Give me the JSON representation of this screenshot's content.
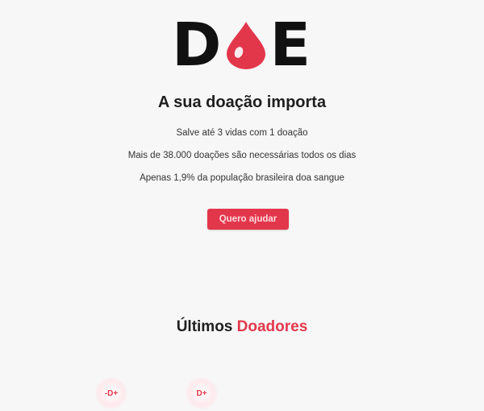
{
  "logo": {
    "left_letter": "D",
    "right_letter": "E",
    "drop_color": "#e2374b"
  },
  "hero": {
    "title": "A sua doação importa",
    "facts": [
      "Salve até 3 vidas com 1 doação",
      "Mais de 38.000 doações são necessárias todos os dias",
      "Apenas 1,9% da população brasileira doa sangue"
    ],
    "cta_label": "Quero ajudar"
  },
  "donors_section": {
    "title_prefix": "Últimos",
    "title_accent": "Doadores",
    "badges": [
      "-D+",
      "D+"
    ]
  },
  "colors": {
    "accent": "#e2374b",
    "background": "#f7f7f8",
    "text": "#1e1e1e"
  }
}
